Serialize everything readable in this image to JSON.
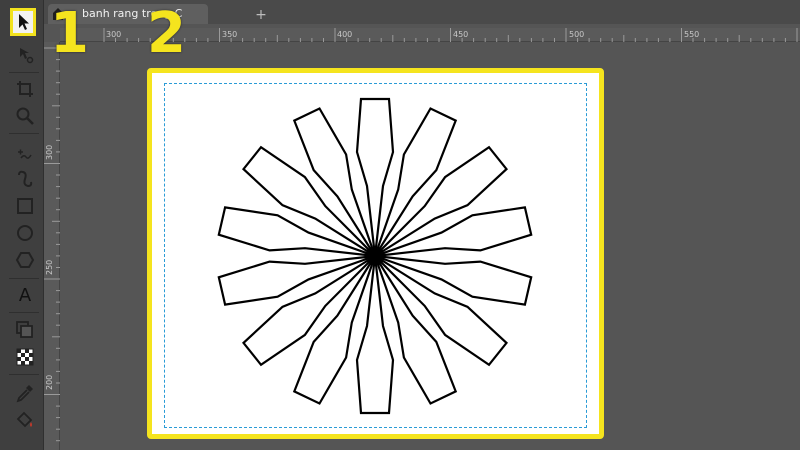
{
  "tabs": [
    {
      "title": "banh rang trong C"
    }
  ],
  "annotations": {
    "step1": "1",
    "step2": "2"
  },
  "ruler": {
    "horizontal": [
      "300",
      "350",
      "400",
      "450",
      "500",
      "550"
    ],
    "vertical": [
      "300",
      "250",
      "200"
    ]
  },
  "toolbar": {
    "text_tool_glyph": "A"
  },
  "colors": {
    "highlight": "#f5e41e",
    "page_margin": "#2a9bd6",
    "canvas_bg": "#555555"
  },
  "icons": [
    "selector-arrow-icon",
    "node-tool-icon",
    "crop-icon",
    "zoom-icon",
    "measure-icon",
    "bezier-pen-icon",
    "rectangle-icon",
    "ellipse-icon",
    "polygon-icon",
    "text-icon",
    "layers-icon",
    "checker-pattern-icon",
    "dropper-icon",
    "paint-bucket-icon"
  ],
  "shape": {
    "petals": 14,
    "stroke": "#000000"
  }
}
